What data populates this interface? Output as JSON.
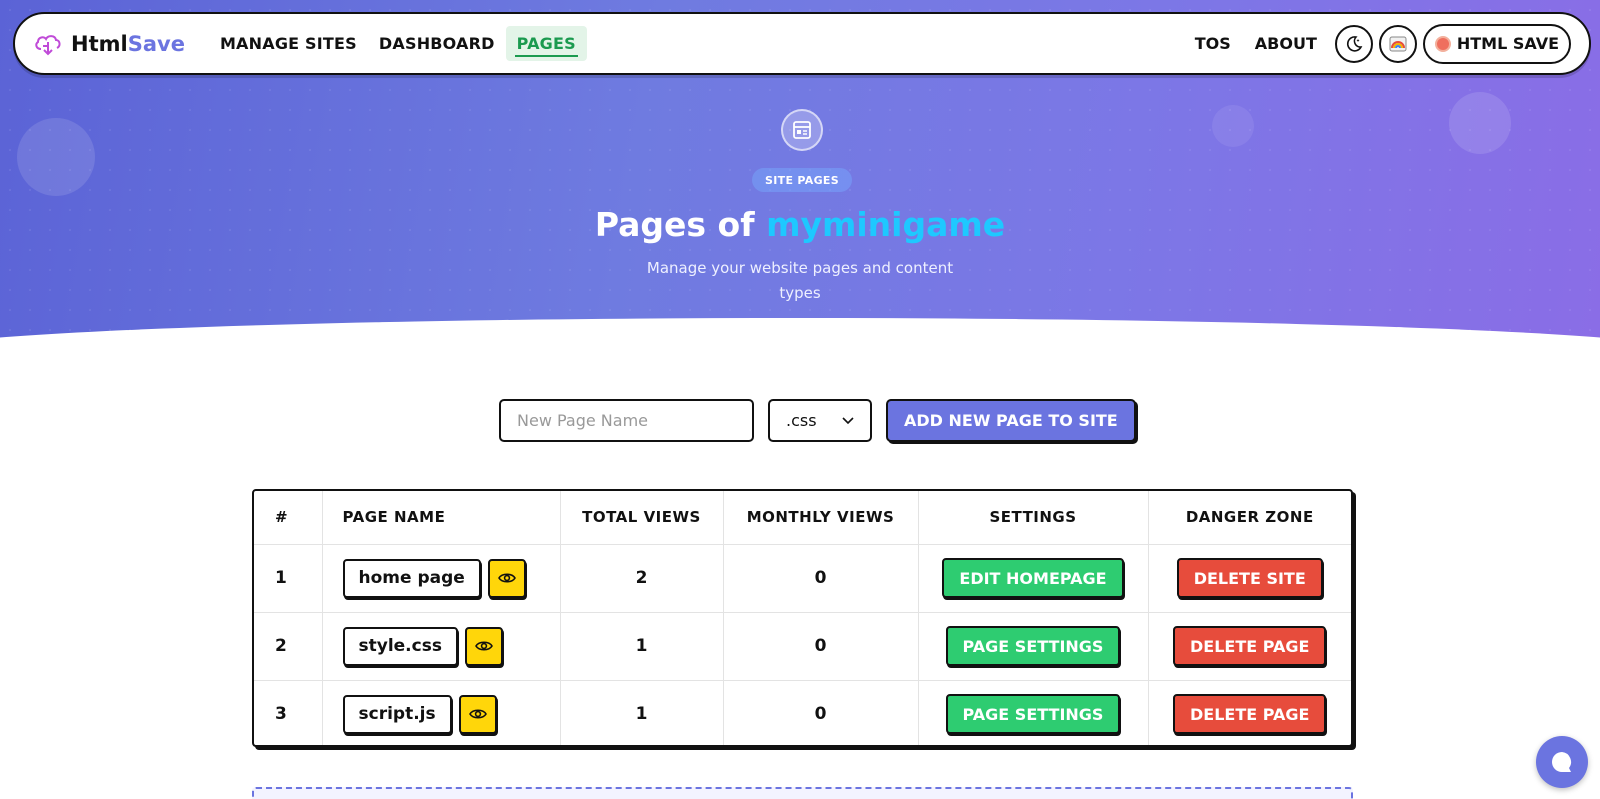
{
  "navbar": {
    "brand_html": "Html",
    "brand_save": "Save",
    "links": [
      {
        "label": "MANAGE SITES",
        "active": false
      },
      {
        "label": "DASHBOARD",
        "active": false
      },
      {
        "label": "PAGES",
        "active": true
      }
    ],
    "right_links": [
      "TOS",
      "ABOUT"
    ],
    "theme_icon": "moon-icon",
    "palette_icon": "rainbow-icon",
    "account_label": "HTML SAVE"
  },
  "hero": {
    "icon": "page-icon",
    "badge": "SITE PAGES",
    "title_prefix": "Pages of ",
    "title_site": "myminigame",
    "subtitle": "Manage your website pages and content types"
  },
  "add_form": {
    "placeholder": "New Page Name",
    "type_selected": ".css",
    "button_label": "ADD NEW PAGE TO SITE"
  },
  "table": {
    "headers": [
      "#",
      "PAGE NAME",
      "TOTAL VIEWS",
      "MONTHLY VIEWS",
      "SETTINGS",
      "DANGER ZONE"
    ],
    "rows": [
      {
        "num": "1",
        "name": "home page",
        "total": "2",
        "monthly": "0",
        "settings": "EDIT HOMEPAGE",
        "danger": "DELETE SITE"
      },
      {
        "num": "2",
        "name": "style.css",
        "total": "1",
        "monthly": "0",
        "settings": "PAGE SETTINGS",
        "danger": "DELETE PAGE"
      },
      {
        "num": "3",
        "name": "script.js",
        "total": "1",
        "monthly": "0",
        "settings": "PAGE SETTINGS",
        "danger": "DELETE PAGE"
      }
    ]
  },
  "colors": {
    "accent": "#6b74e0",
    "green": "#2ecc71",
    "red": "#e74c3c",
    "yellow": "#ffd60a",
    "site_name": "#1ec8ff"
  }
}
